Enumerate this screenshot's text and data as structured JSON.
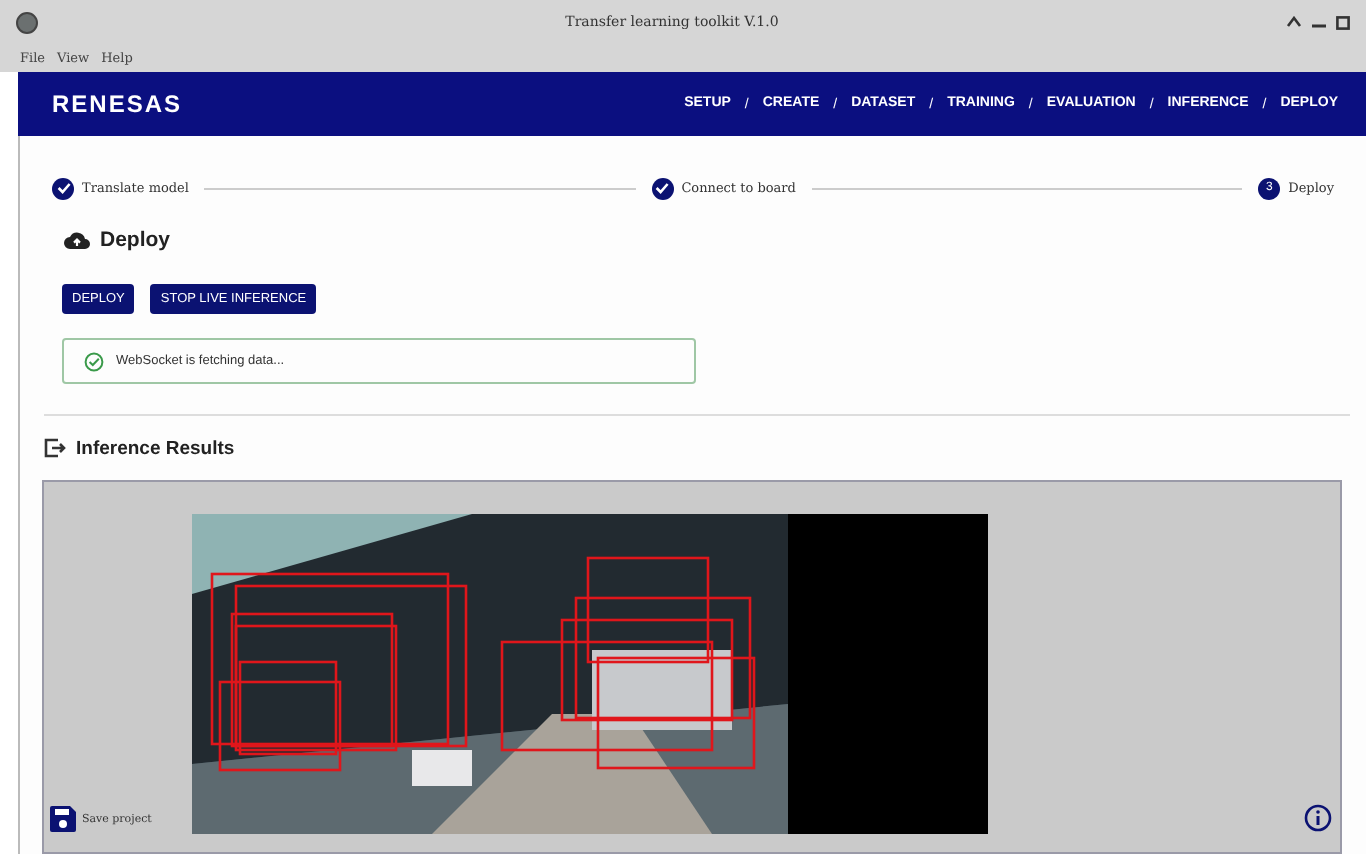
{
  "window": {
    "title": "Transfer learning toolkit V.1.0"
  },
  "menu": [
    "File",
    "View",
    "Help"
  ],
  "brand": "RENESAS",
  "nav": [
    {
      "label": "SETUP"
    },
    {
      "label": "CREATE"
    },
    {
      "label": "DATASET"
    },
    {
      "label": "TRAINING"
    },
    {
      "label": "EVALUATION"
    },
    {
      "label": "INFERENCE"
    },
    {
      "label": "DEPLOY"
    }
  ],
  "nav_separator": "/",
  "steps": [
    {
      "label": "Translate model",
      "done": true
    },
    {
      "label": "Connect to board",
      "done": true
    },
    {
      "label": "Deploy",
      "done": false,
      "number": "3"
    }
  ],
  "deploy": {
    "title": "Deploy",
    "buttons": [
      "DEPLOY",
      "STOP LIVE INFERENCE"
    ],
    "status": "WebSocket is fetching data..."
  },
  "results": {
    "title": "Inference Results"
  },
  "save": "Save project"
}
